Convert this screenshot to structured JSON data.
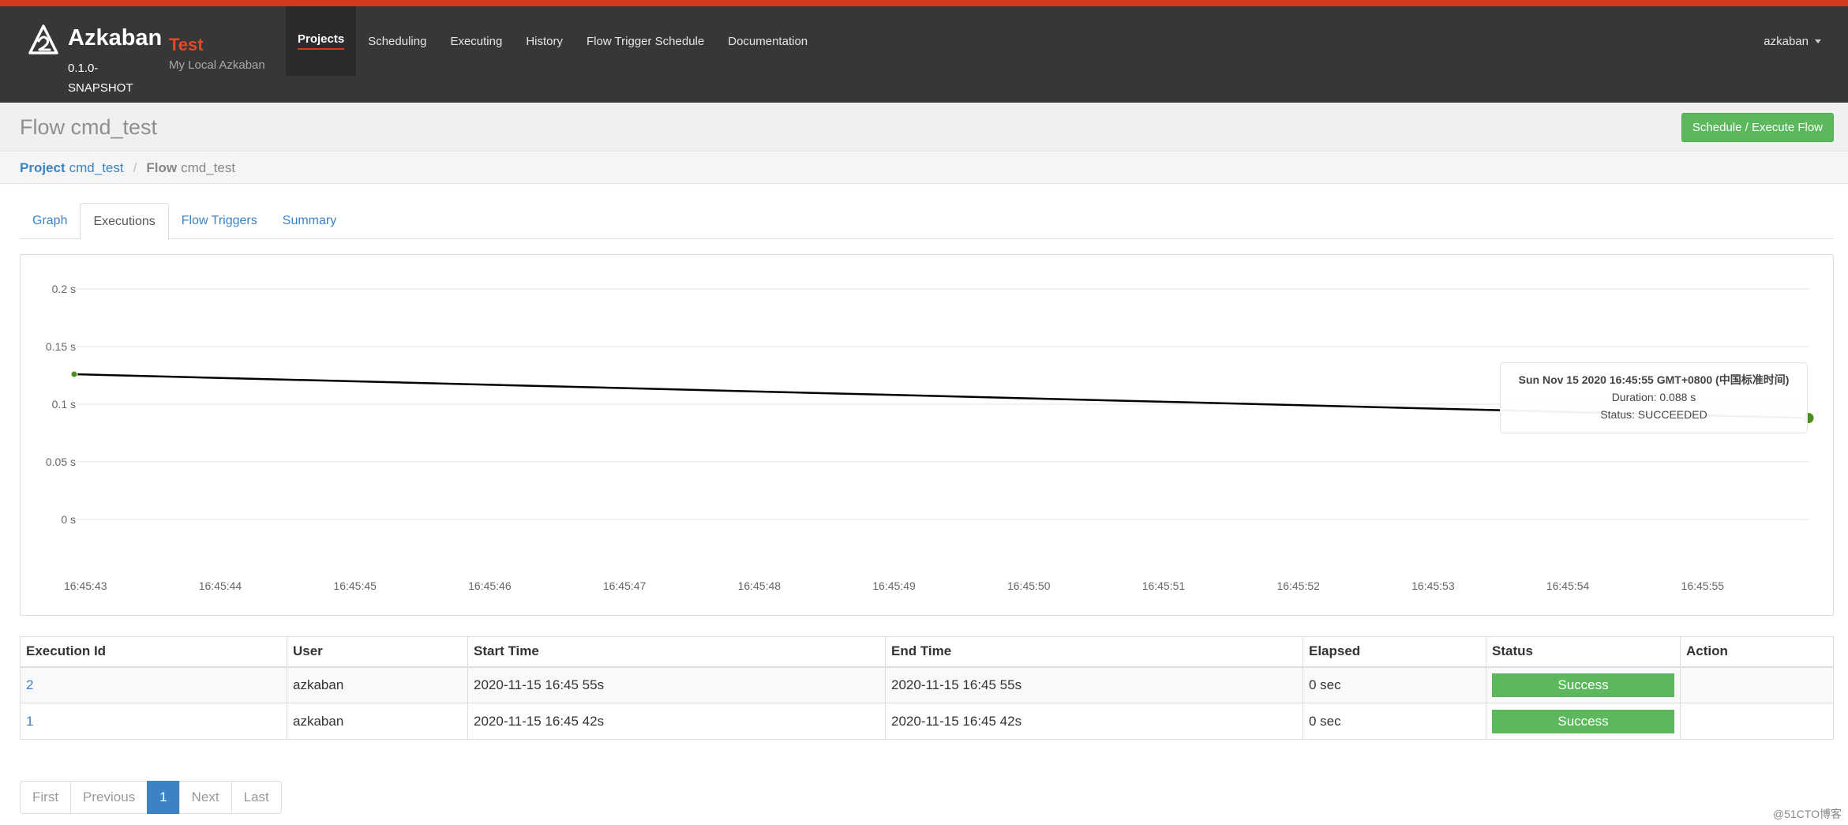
{
  "header": {
    "brand": "Azkaban",
    "version": "0.1.0-SNAPSHOT",
    "env_name": "Test",
    "env_desc": "My Local Azkaban",
    "nav": [
      {
        "label": "Projects",
        "active": true
      },
      {
        "label": "Scheduling"
      },
      {
        "label": "Executing"
      },
      {
        "label": "History"
      },
      {
        "label": "Flow Trigger Schedule"
      },
      {
        "label": "Documentation"
      }
    ],
    "user": "azkaban"
  },
  "page": {
    "title": "Flow cmd_test",
    "execute_button": "Schedule / Execute Flow"
  },
  "breadcrumb": {
    "project_key": "Project",
    "project_name": "cmd_test",
    "flow_key": "Flow",
    "flow_name": "cmd_test"
  },
  "tabs": [
    {
      "label": "Graph"
    },
    {
      "label": "Executions",
      "active": true
    },
    {
      "label": "Flow Triggers"
    },
    {
      "label": "Summary"
    }
  ],
  "chart_data": {
    "type": "line",
    "y_ticks": [
      "0.2 s",
      "0.15 s",
      "0.1 s",
      "0.05 s",
      "0 s"
    ],
    "y_values": [
      0.2,
      0.15,
      0.1,
      0.05,
      0
    ],
    "ylim": [
      0,
      0.2
    ],
    "x_ticks": [
      "16:45:43",
      "16:45:44",
      "16:45:45",
      "16:45:46",
      "16:45:47",
      "16:45:48",
      "16:45:49",
      "16:45:50",
      "16:45:51",
      "16:45:52",
      "16:45:53",
      "16:45:54",
      "16:45:55"
    ],
    "x_tick_seconds": [
      43,
      44,
      45,
      46,
      47,
      48,
      49,
      50,
      51,
      52,
      53,
      54,
      55
    ],
    "xlim_seconds": [
      43,
      55.77
    ],
    "points": [
      {
        "x": "16:45:42.9",
        "x_seconds": 42.9,
        "y": 0.126
      },
      {
        "x": "16:45:55.7",
        "x_seconds": 55.77,
        "y": 0.088
      }
    ],
    "grid": true,
    "colors": {
      "line": "#000000",
      "point": "#4a8f1e",
      "grid": "#e6e6e6"
    }
  },
  "tooltip": {
    "date": "Sun Nov 15 2020 16:45:55 GMT+0800 (中国标准时间)",
    "duration": "Duration: 0.088 s",
    "status": "Status: SUCCEEDED"
  },
  "table": {
    "headers": [
      "Execution Id",
      "User",
      "Start Time",
      "End Time",
      "Elapsed",
      "Status",
      "Action"
    ],
    "rows": [
      {
        "id": "2",
        "user": "azkaban",
        "start": "2020-11-15 16:45 55s",
        "end": "2020-11-15 16:45 55s",
        "elapsed": "0 sec",
        "status": "Success",
        "action": ""
      },
      {
        "id": "1",
        "user": "azkaban",
        "start": "2020-11-15 16:45 42s",
        "end": "2020-11-15 16:45 42s",
        "elapsed": "0 sec",
        "status": "Success",
        "action": ""
      }
    ]
  },
  "pagination": {
    "first": "First",
    "previous": "Previous",
    "current": "1",
    "next": "Next",
    "last": "Last"
  },
  "watermark": "@51CTO博客",
  "colors": {
    "accent": "#d23b1e",
    "navbar": "#373737",
    "success": "#5cb85c",
    "link": "#3c83c5"
  }
}
